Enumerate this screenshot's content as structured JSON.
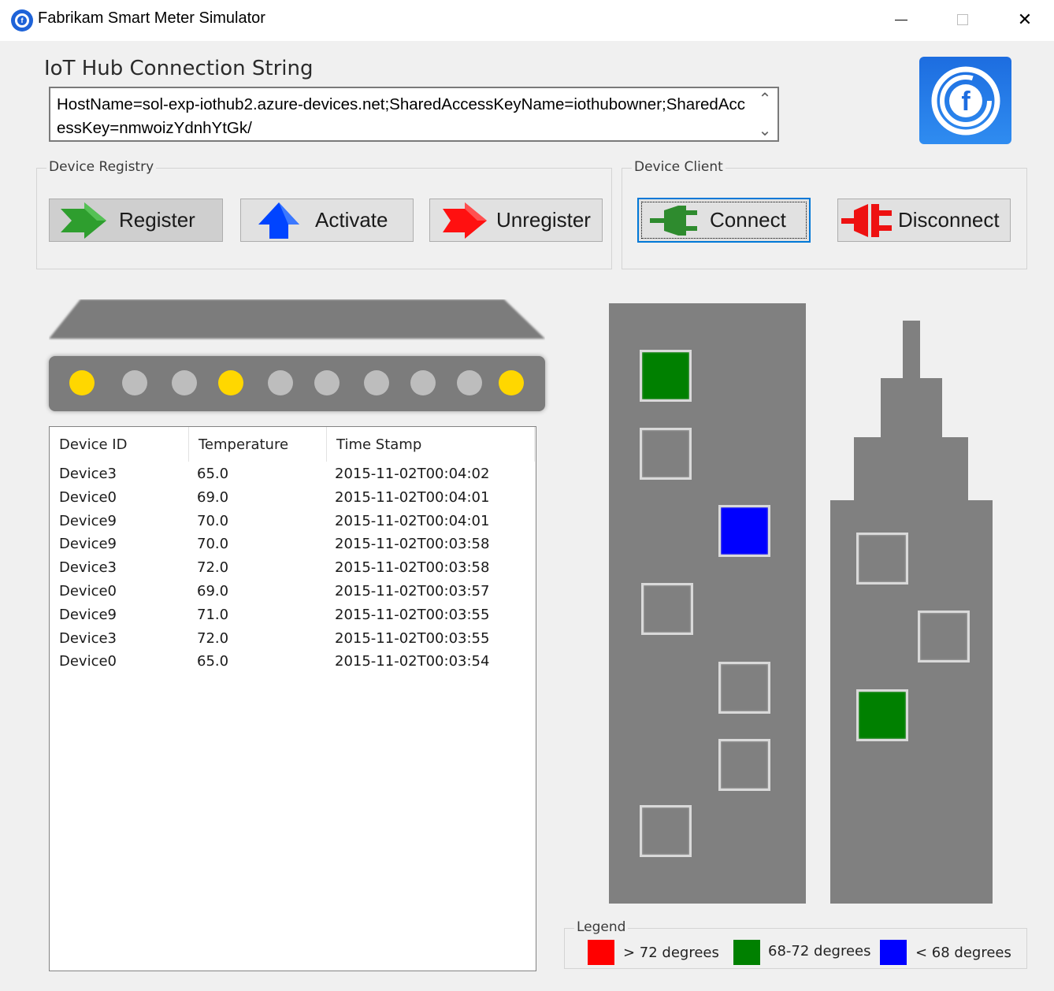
{
  "window": {
    "title": "Fabrikam Smart Meter Simulator",
    "icon_glyph": "f",
    "close_glyph": "✕"
  },
  "connection": {
    "label": "IoT Hub Connection String",
    "value": "HostName=sol-exp-iothub2.azure-devices.net;SharedAccessKeyName=iothubowner;SharedAccessKey=nmwoizYdnhYtGk/",
    "scroll_up": "⌃",
    "scroll_down": "⌄"
  },
  "registry": {
    "label": "Device Registry",
    "register": "Register",
    "activate": "Activate",
    "unregister": "Unregister"
  },
  "client": {
    "label": "Device Client",
    "connect": "Connect",
    "disconnect": "Disconnect"
  },
  "leds": [
    "#ffd700",
    "#bdbdbd",
    "#bdbdbd",
    "#ffd700",
    "#bdbdbd",
    "#bdbdbd",
    "#bdbdbd",
    "#bdbdbd",
    "#bdbdbd",
    "#ffd700"
  ],
  "table": {
    "headers": [
      "Device ID",
      "Temperature",
      "Time Stamp"
    ],
    "rows": [
      [
        "Device3",
        "65.0",
        "2015-11-02T00:04:02"
      ],
      [
        "Device0",
        "69.0",
        "2015-11-02T00:04:01"
      ],
      [
        "Device9",
        "70.0",
        "2015-11-02T00:04:01"
      ],
      [
        "Device9",
        "70.0",
        "2015-11-02T00:03:58"
      ],
      [
        "Device3",
        "72.0",
        "2015-11-02T00:03:58"
      ],
      [
        "Device0",
        "69.0",
        "2015-11-02T00:03:57"
      ],
      [
        "Device9",
        "71.0",
        "2015-11-02T00:03:55"
      ],
      [
        "Device3",
        "72.0",
        "2015-11-02T00:03:55"
      ],
      [
        "Device0",
        "65.0",
        "2015-11-02T00:03:54"
      ]
    ]
  },
  "colors": {
    "hot": "#ff0000",
    "normal": "#008000",
    "cold": "#0000ff",
    "empty": "#808080",
    "building": "#808080"
  },
  "buildings": {
    "left_windows": [
      "normal",
      "empty",
      "cold",
      "empty",
      "empty",
      "empty",
      "empty"
    ],
    "right_windows": [
      "empty",
      "empty",
      "normal"
    ]
  },
  "legend": {
    "label": "Legend",
    "items": [
      {
        "text": "> 72 degrees",
        "color": "#ff0000"
      },
      {
        "text": "68-72 degrees",
        "color": "#008000"
      },
      {
        "text": "< 68 degrees",
        "color": "#0000ff"
      }
    ]
  }
}
